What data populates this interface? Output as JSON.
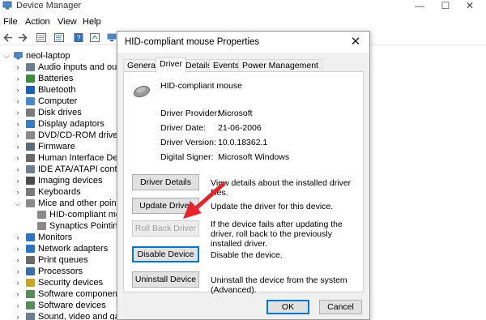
{
  "window": {
    "title": "Device Manager",
    "controls": {
      "minimize": "—",
      "maximize": "☐",
      "close": "✕"
    }
  },
  "menu": [
    "File",
    "Action",
    "View",
    "Help"
  ],
  "tree": {
    "root": "neol-laptop",
    "items": [
      {
        "label": "Audio inputs and outputs",
        "expanded": false,
        "color": "#6b7d8f"
      },
      {
        "label": "Batteries",
        "expanded": false,
        "color": "#3d8b3d"
      },
      {
        "label": "Bluetooth",
        "expanded": false,
        "color": "#1e5fb5"
      },
      {
        "label": "Computer",
        "expanded": false,
        "color": "#4a88c7"
      },
      {
        "label": "Disk drives",
        "expanded": false,
        "color": "#7a7a7a"
      },
      {
        "label": "Display adaptors",
        "expanded": false,
        "color": "#3a7cc0"
      },
      {
        "label": "DVD/CD-ROM drives",
        "expanded": false,
        "color": "#8a8a8a"
      },
      {
        "label": "Firmware",
        "expanded": false,
        "color": "#5c6b7a"
      },
      {
        "label": "Human Interface Devices",
        "expanded": false,
        "color": "#6a6a6a"
      },
      {
        "label": "IDE ATA/ATAPI controllers",
        "expanded": false,
        "color": "#6e7f8f"
      },
      {
        "label": "Imaging devices",
        "expanded": false,
        "color": "#4d4d4d"
      },
      {
        "label": "Keyboards",
        "expanded": false,
        "color": "#7a7a7a"
      },
      {
        "label": "Mice and other pointing devices",
        "expanded": true,
        "color": "#8a8a8a"
      },
      {
        "label": "HID-compliant mouse",
        "child": true,
        "color": "#8a8a8a"
      },
      {
        "label": "Synaptics Pointing Device",
        "child": true,
        "color": "#8a8a8a"
      },
      {
        "label": "Monitors",
        "expanded": false,
        "color": "#2f74c0"
      },
      {
        "label": "Network adapters",
        "expanded": false,
        "color": "#2f74c0"
      },
      {
        "label": "Print queues",
        "expanded": false,
        "color": "#6a6a6a"
      },
      {
        "label": "Processors",
        "expanded": false,
        "color": "#3a6ea5"
      },
      {
        "label": "Security devices",
        "expanded": false,
        "color": "#c9a227"
      },
      {
        "label": "Software components",
        "expanded": false,
        "color": "#5a8a5a"
      },
      {
        "label": "Software devices",
        "expanded": false,
        "color": "#5a8a5a"
      },
      {
        "label": "Sound, video and game controllers",
        "expanded": false,
        "color": "#6b7d8f"
      }
    ]
  },
  "dialog": {
    "title": "HID-compliant mouse Properties",
    "close": "✕",
    "tabs": [
      "General",
      "Driver",
      "Details",
      "Events",
      "Power Management"
    ],
    "active_tab": "Driver",
    "device_name": "HID-compliant mouse",
    "info": [
      {
        "label": "Driver Provider:",
        "value": "Microsoft"
      },
      {
        "label": "Driver Date:",
        "value": "21-06-2006"
      },
      {
        "label": "Driver Version:",
        "value": "10.0.18362.1"
      },
      {
        "label": "Digital Signer:",
        "value": "Microsoft Windows"
      }
    ],
    "buttons": [
      {
        "label": "Driver Details",
        "desc": "View details about the installed driver files."
      },
      {
        "label": "Update Driver",
        "desc": "Update the driver for this device."
      },
      {
        "label": "Roll Back Driver",
        "desc": "If the device fails after updating the driver, roll back to the previously installed driver."
      },
      {
        "label": "Disable Device",
        "desc": "Disable the device."
      },
      {
        "label": "Uninstall Device",
        "desc": "Uninstall the device from the system (Advanced)."
      }
    ],
    "ok": "OK",
    "cancel": "Cancel"
  },
  "colors": {
    "accent": "#0078d7",
    "arrow": "#e8232a"
  }
}
